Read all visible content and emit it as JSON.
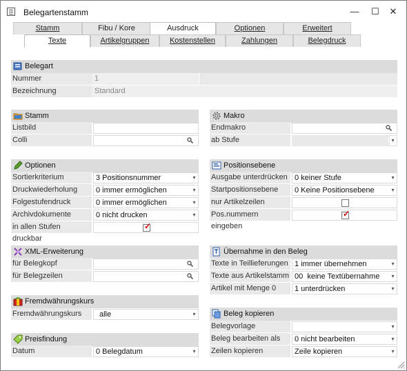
{
  "window": {
    "title": "Belegartenstamm",
    "minimize": "—",
    "maximize": "☐",
    "close": "✕"
  },
  "tabs_row1": [
    "Stamm",
    "Fibu / Kore",
    "Ausdruck",
    "Optionen",
    "Erweitert"
  ],
  "tabs_row2": [
    "Texte",
    "Artikelgruppen",
    "Kostenstellen",
    "Zahlungen",
    "Belegdruck"
  ],
  "belegart": {
    "title": "Belegart",
    "nummer_label": "Nummer",
    "nummer_value": "1",
    "bezeichnung_label": "Bezeichnung",
    "bezeichnung_value": "Standard"
  },
  "stamm": {
    "title": "Stamm",
    "listbild_label": "Listbild",
    "listbild_value": "",
    "colli_label": "Colli",
    "colli_value": ""
  },
  "makro": {
    "title": "Makro",
    "endmakro_label": "Endmakro",
    "endmakro_value": "",
    "abstufe_label": "ab Stufe",
    "abstufe_value": ""
  },
  "optionen": {
    "title": "Optionen",
    "sortier_label": "Sortierkriterium",
    "sortier_value": "3 Positionsnummer",
    "druckwdh_label": "Druckwiederholung",
    "druckwdh_value": "0 immer ermöglichen",
    "folgestufe_label": "Folgestufendruck",
    "folgestufe_value": "0 immer ermöglichen",
    "archiv_label": "Archivdokumente",
    "archiv_value": "0 nicht drucken",
    "allestufen_label": "in allen Stufen druckbar",
    "allestufen_checked": true
  },
  "positionsebene": {
    "title": "Positionsebene",
    "ausgabe_label": "Ausgabe unterdrücken",
    "ausgabe_value": "0 keiner Stufe",
    "startpos_label": "Startpositionsebene",
    "startpos_value": "0 Keine Positionsebene",
    "nurartikel_label": "nur Artikelzeilen",
    "nurartikel_checked": false,
    "posnummern_label": "Pos.nummern eingeben",
    "posnummern_checked": true
  },
  "xml": {
    "title": "XML-Erweiterung",
    "kopf_label": "für Belegkopf",
    "kopf_value": "",
    "zeilen_label": "für Belegzeilen",
    "zeilen_value": ""
  },
  "uebernahme": {
    "title": "Übernahme in den Beleg",
    "teillief_label": "Texte in Teillieferungen",
    "teillief_value": "1 immer übernehmen",
    "artstamm_label": "Texte aus Artikelstamm",
    "artstamm_value": "00  keine Textübernahme",
    "menge0_label": "Artikel mit Menge 0",
    "menge0_value": "1 unterdrücken"
  },
  "fremdwaehrung": {
    "title": "Fremdwährungskurs",
    "label": "Fremdwährungskurs",
    "value": "alle"
  },
  "preisfindung": {
    "title": "Preisfindung",
    "datum_label": "Datum",
    "datum_value": "0 Belegdatum"
  },
  "belegkopieren": {
    "title": "Beleg kopieren",
    "vorlage_label": "Belegvorlage",
    "vorlage_value": "",
    "bearbeiten_label": "Beleg bearbeiten als",
    "bearbeiten_value": "0 nicht bearbeiten",
    "zeilen_label": "Zeilen kopieren",
    "zeilen_value": "Zeile kopieren"
  },
  "colors": {
    "section_bg": "#dcdcdc",
    "label_bg": "#e9e9e9",
    "check_red": "#dd0000"
  },
  "icons": [
    "window-icon",
    "folder-icon",
    "gear-icon",
    "pencil-icon",
    "positions-icon",
    "xml-icon",
    "transfer-icon",
    "currency-icon",
    "price-icon",
    "copy-icon",
    "search-icon",
    "dropdown-icon",
    "resize-grip-icon"
  ]
}
